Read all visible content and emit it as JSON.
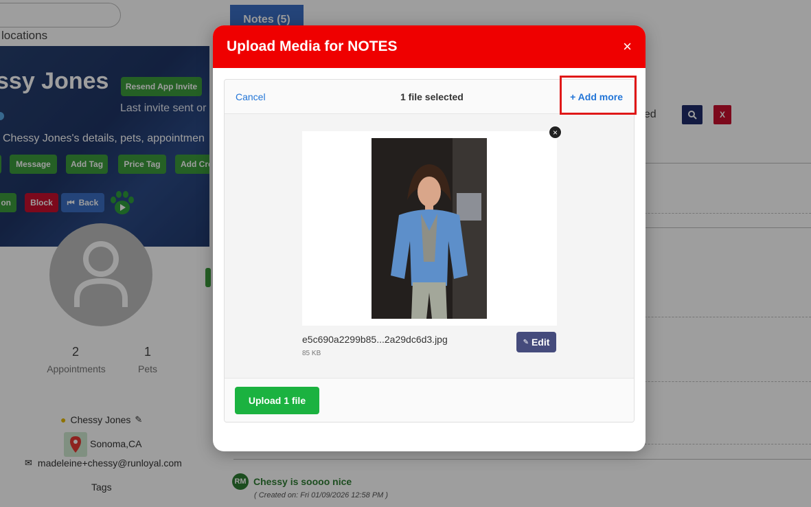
{
  "background": {
    "locations_text": "locations",
    "profile_name": "ssy Jones",
    "resend_invite_label": "Resend App Invite",
    "last_invite_text": "Last invite sent or",
    "details_text": "Chessy Jones's details, pets, appointmen",
    "buttons_row1": [
      "Message",
      "Add Tag",
      "Price Tag",
      "Add Cre"
    ],
    "buttons_row2": [
      "on",
      "Block",
      "Back"
    ],
    "stats": [
      {
        "value": "2",
        "label": "Appointments"
      },
      {
        "value": "1",
        "label": "Pets"
      }
    ],
    "owner_name": "Chessy Jones",
    "location": "Sonoma,CA",
    "email": "madeleine+chessy@runloyal.com",
    "tags_label": "Tags",
    "notes_tab_label": "Notes (5)",
    "right_partial_text": "ned",
    "close_label": "X",
    "note": {
      "initials": "RM",
      "text": "Chessy is soooo nice",
      "meta": "( Created on: Fri 01/09/2026 12:58 PM )"
    }
  },
  "modal": {
    "title": "Upload Media for NOTES",
    "close_symbol": "×",
    "cancel_label": "Cancel",
    "selected_text": "1 file selected",
    "add_more_label": "+ Add more",
    "file": {
      "name": "e5c690a2299b85...2a29dc6d3.jpg",
      "size": "85 KB",
      "edit_label": "Edit",
      "remove_symbol": "×"
    },
    "upload_label": "Upload 1 file"
  },
  "colors": {
    "modal_header": "#ef0000",
    "upload_button": "#1bb240",
    "edit_button": "#454b7c",
    "link": "#2275d7",
    "highlight": "#e01818"
  },
  "icons": [
    "close-icon",
    "user-icon",
    "pencil-icon",
    "map-pin-icon",
    "envelope-icon",
    "search-icon",
    "paw-icon",
    "back-icon"
  ]
}
